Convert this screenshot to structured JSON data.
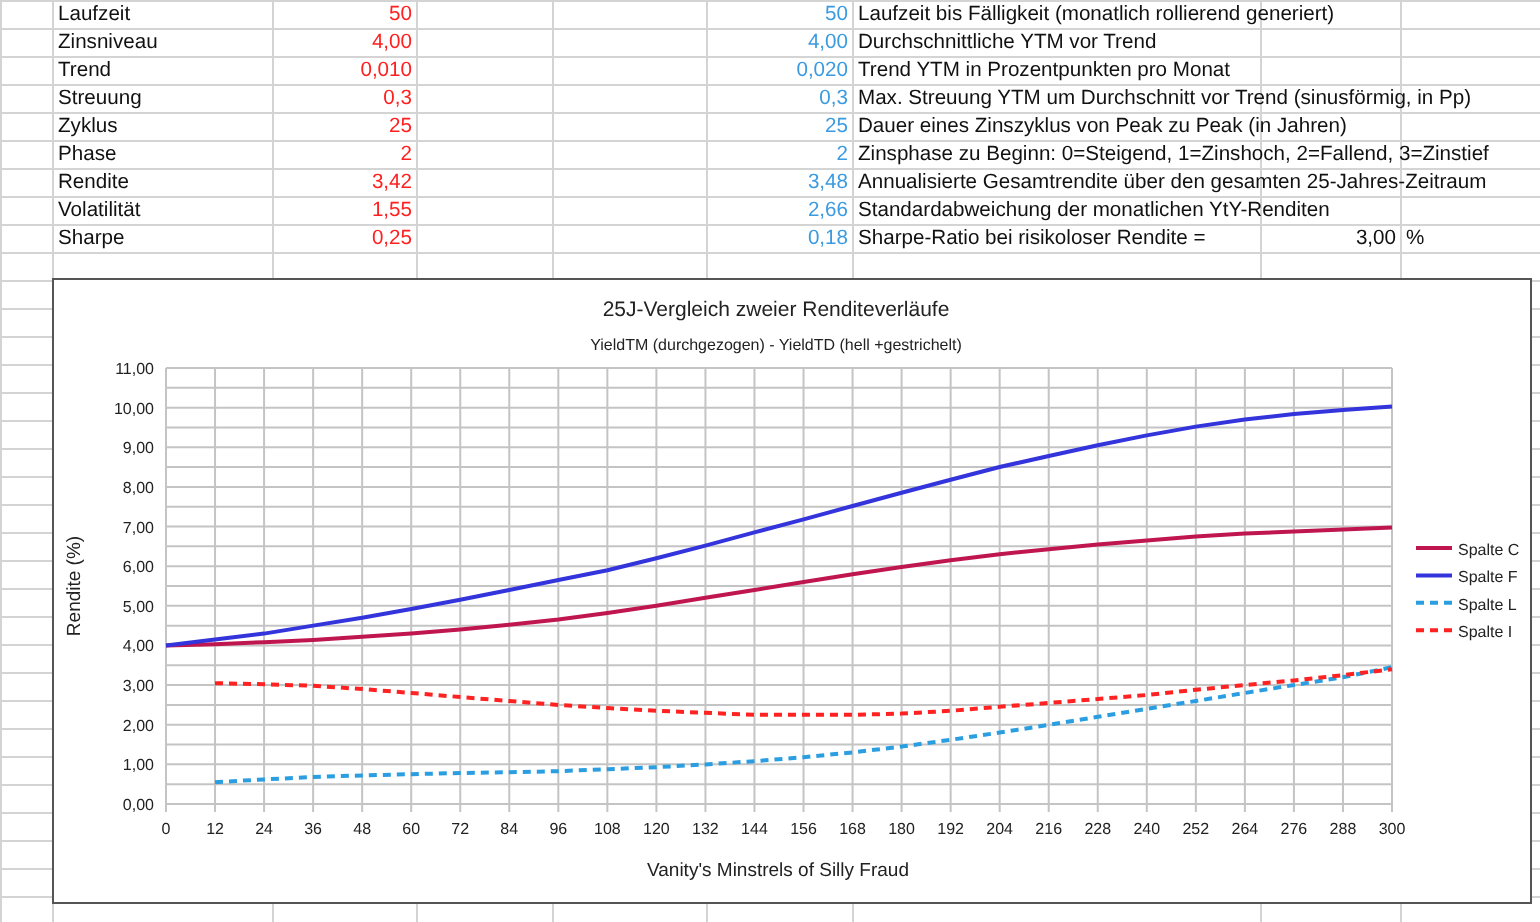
{
  "sheet": {
    "rows": [
      {
        "label": "Laufzeit",
        "value_a": "50",
        "value_b": "50",
        "description": "Laufzeit bis Fälligkeit (monatlich rollierend generiert)"
      },
      {
        "label": "Zinsniveau",
        "value_a": "4,00",
        "value_b": "4,00",
        "description": "Durchschnittliche YTM vor Trend"
      },
      {
        "label": "Trend",
        "value_a": "0,010",
        "value_b": "0,020",
        "description": "Trend YTM in Prozentpunkten pro Monat"
      },
      {
        "label": "Streuung",
        "value_a": "0,3",
        "value_b": "0,3",
        "description": "Max. Streuung YTM um Durchschnitt vor Trend (sinusförmig, in Pp)"
      },
      {
        "label": "Zyklus",
        "value_a": "25",
        "value_b": "25",
        "description": "Dauer eines Zinszyklus von Peak zu Peak (in Jahren)"
      },
      {
        "label": "Phase",
        "value_a": "2",
        "value_b": "2",
        "description": "Zinsphase zu Beginn: 0=Steigend, 1=Zinshoch, 2=Fallend, 3=Zinstief"
      },
      {
        "label": "Rendite",
        "value_a": "3,42",
        "value_b": "3,48",
        "description": "Annualisierte Gesamtrendite über den gesamten 25-Jahres-Zeitraum"
      },
      {
        "label": "Volatilität",
        "value_a": "1,55",
        "value_b": "2,66",
        "description": "Standardabweichung der monatlichen YtY-Renditen"
      },
      {
        "label": "Sharpe",
        "value_a": "0,25",
        "value_b": "0,18",
        "description": "Sharpe-Ratio bei risikoloser Rendite =",
        "rate": "3,00",
        "unit": "%"
      }
    ]
  },
  "chart": {
    "subtitle": "YieldTM (durchgezogen) - YieldTD (hell +gestrichelt)",
    "chart_data": {
      "type": "line",
      "title": "25J-Vergleich zweier Renditeverläufe",
      "xlabel": "Vanity's Minstrels of Silly Fraud",
      "ylabel": "Rendite (%)",
      "x": [
        0,
        12,
        24,
        36,
        48,
        60,
        72,
        84,
        96,
        108,
        120,
        132,
        144,
        156,
        168,
        180,
        192,
        204,
        216,
        228,
        240,
        252,
        264,
        276,
        288,
        300
      ],
      "grid": true,
      "legend": "right",
      "xlim": [
        0,
        300
      ],
      "ylim": [
        0,
        11
      ],
      "xticks": [
        0,
        12,
        24,
        36,
        48,
        60,
        72,
        84,
        96,
        108,
        120,
        132,
        144,
        156,
        168,
        180,
        192,
        204,
        216,
        228,
        240,
        252,
        264,
        276,
        288,
        300
      ],
      "yticks": [
        {
          "value": 0,
          "label": "0,00"
        },
        {
          "value": 1,
          "label": "1,00"
        },
        {
          "value": 2,
          "label": "2,00"
        },
        {
          "value": 3,
          "label": "3,00"
        },
        {
          "value": 4,
          "label": "4,00"
        },
        {
          "value": 5,
          "label": "5,00"
        },
        {
          "value": 6,
          "label": "6,00"
        },
        {
          "value": 7,
          "label": "7,00"
        },
        {
          "value": 8,
          "label": "8,00"
        },
        {
          "value": 9,
          "label": "9,00"
        },
        {
          "value": 10,
          "label": "10,00"
        },
        {
          "value": 11,
          "label": "11,00"
        }
      ],
      "series": [
        {
          "name": "Spalte C",
          "color": "#c01650",
          "line_style": "solid",
          "values": [
            4.0,
            4.03,
            4.08,
            4.14,
            4.22,
            4.3,
            4.4,
            4.52,
            4.65,
            4.82,
            5.0,
            5.2,
            5.4,
            5.6,
            5.8,
            5.98,
            6.15,
            6.3,
            6.43,
            6.55,
            6.65,
            6.75,
            6.82,
            6.88,
            6.93,
            6.98
          ]
        },
        {
          "name": "Spalte F",
          "color": "#3434dc",
          "line_style": "solid",
          "values": [
            4.0,
            4.15,
            4.3,
            4.5,
            4.7,
            4.92,
            5.15,
            5.4,
            5.65,
            5.9,
            6.2,
            6.52,
            6.85,
            7.18,
            7.52,
            7.85,
            8.18,
            8.5,
            8.78,
            9.05,
            9.3,
            9.52,
            9.7,
            9.84,
            9.94,
            10.03
          ]
        },
        {
          "name": "Spalte L",
          "color": "#2a9ee0",
          "line_style": "dashed",
          "values": [
            null,
            0.55,
            0.62,
            0.68,
            0.72,
            0.75,
            0.78,
            0.8,
            0.83,
            0.88,
            0.93,
            1.0,
            1.08,
            1.18,
            1.3,
            1.45,
            1.62,
            1.8,
            2.0,
            2.2,
            2.4,
            2.6,
            2.8,
            3.0,
            3.2,
            3.45
          ]
        },
        {
          "name": "Spalte I",
          "color": "#ff2222",
          "line_style": "dashed",
          "values": [
            null,
            3.05,
            3.02,
            2.98,
            2.9,
            2.8,
            2.7,
            2.6,
            2.5,
            2.42,
            2.35,
            2.3,
            2.25,
            2.25,
            2.25,
            2.28,
            2.35,
            2.45,
            2.55,
            2.65,
            2.75,
            2.88,
            3.0,
            3.12,
            3.25,
            3.4
          ]
        }
      ]
    }
  }
}
